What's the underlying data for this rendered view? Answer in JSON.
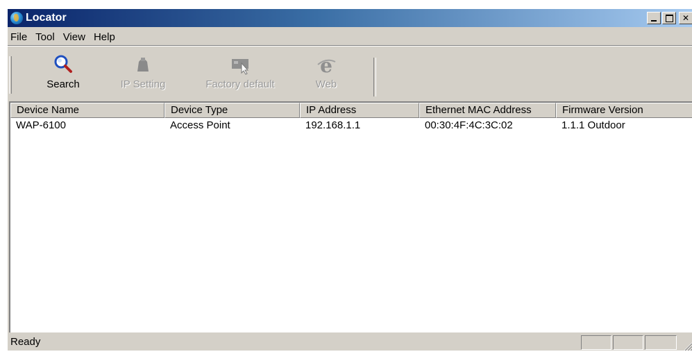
{
  "window": {
    "title": "Locator"
  },
  "menu": [
    "File",
    "Tool",
    "View",
    "Help"
  ],
  "toolbar": {
    "buttons": [
      {
        "label": "Search",
        "icon": "search-icon",
        "enabled": true
      },
      {
        "label": "IP Setting",
        "icon": "network-icon",
        "enabled": false
      },
      {
        "label": "Factory default",
        "icon": "factory-default-icon",
        "enabled": false
      },
      {
        "label": "Web",
        "icon": "web-icon",
        "enabled": false
      }
    ]
  },
  "table": {
    "columns": [
      "Device Name",
      "Device Type",
      "IP Address",
      "Ethernet MAC Address",
      "Firmware Version"
    ],
    "rows": [
      [
        "WAP-6100",
        "Access Point",
        "192.168.1.1",
        "00:30:4F:4C:3C:02",
        "1.1.1 Outdoor"
      ]
    ]
  },
  "status": {
    "text": "Ready"
  },
  "colors": {
    "titlebar_start": "#0a246a",
    "titlebar_end": "#a6caf0",
    "chrome": "#d4d0c8"
  }
}
